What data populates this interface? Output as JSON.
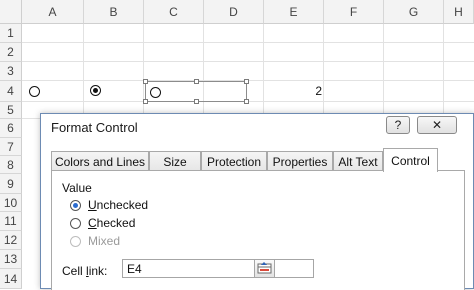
{
  "sheet": {
    "columns": [
      "A",
      "B",
      "C",
      "D",
      "E",
      "F",
      "G",
      "H"
    ],
    "rows": [
      "1",
      "2",
      "3",
      "4",
      "5",
      "6",
      "7",
      "8",
      "9",
      "10",
      "11",
      "12",
      "13",
      "14"
    ],
    "cell_e4_value": "2",
    "option_button_checked": "B4"
  },
  "dialog": {
    "title": "Format Control",
    "help_label": "?",
    "close_label": "✕",
    "tabs": [
      {
        "label": "Colors and Lines"
      },
      {
        "label": "Size"
      },
      {
        "label": "Protection"
      },
      {
        "label": "Properties"
      },
      {
        "label": "Alt Text"
      },
      {
        "label": "Control"
      }
    ],
    "active_tab": "Control",
    "value_group_label": "Value",
    "options": [
      {
        "first": "U",
        "rest": "nchecked",
        "selected": true,
        "enabled": true
      },
      {
        "first": "C",
        "rest": "hecked",
        "selected": false,
        "enabled": true
      },
      {
        "first": "",
        "rest": "Mixed",
        "selected": false,
        "enabled": false
      }
    ],
    "cell_link_prefix": "Cell ",
    "cell_link_ul": "l",
    "cell_link_suffix": "ink:",
    "cell_link_value": "E4"
  }
}
